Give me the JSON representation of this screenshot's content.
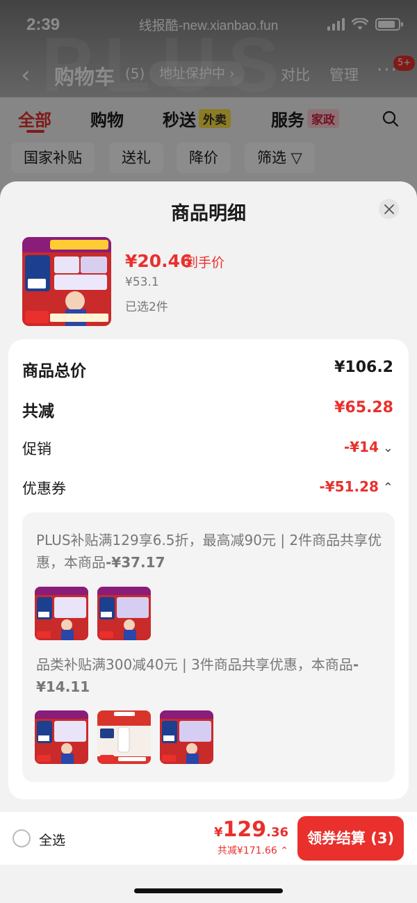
{
  "status_bar": {
    "time": "2:39",
    "url": "线报酷-new.xianbao.fun"
  },
  "cart_header": {
    "title": "购物车",
    "count": "(5)",
    "address_protect": "地址保护中",
    "compare": "对比",
    "manage": "管理",
    "more_badge": "5+"
  },
  "category_tabs": [
    {
      "label": "全部",
      "tag": ""
    },
    {
      "label": "购物",
      "tag": ""
    },
    {
      "label": "秒送",
      "tag": "外卖"
    },
    {
      "label": "服务",
      "tag": "家政"
    }
  ],
  "filter_chips": [
    "国家补贴",
    "送礼",
    "降价",
    "筛选"
  ],
  "sheet": {
    "title": "商品明细",
    "product": {
      "price": "¥20.46",
      "price_tag": "到手价",
      "original_price": "¥53.1",
      "selected": "已选2件"
    },
    "rows": {
      "total_label": "商品总价",
      "total_value": "¥106.2",
      "reduce_label": "共减",
      "reduce_value": "¥65.28",
      "promo_label": "促销",
      "promo_value": "-¥14",
      "coupon_label": "优惠券",
      "coupon_value": "-¥51.28"
    },
    "coupons": [
      {
        "text_prefix": "PLUS补贴满129享6.5折，最高减90元 | 2件商品共享优惠，本商品",
        "amount": "-¥37.17"
      },
      {
        "text_prefix": "品类补贴满300减40元 | 3件商品共享优惠，本商品",
        "amount": "-¥14.11"
      }
    ]
  },
  "bottom_bar": {
    "select_all": "全选",
    "total_symbol": "¥",
    "total_int": "129",
    "total_dec": ".36",
    "total_save": "共减¥171.66",
    "checkout": "领券结算 (3)"
  },
  "colors": {
    "accent": "#e9302d",
    "sheet_bg": "#f2f2f2",
    "card_bg": "#ffffff"
  }
}
